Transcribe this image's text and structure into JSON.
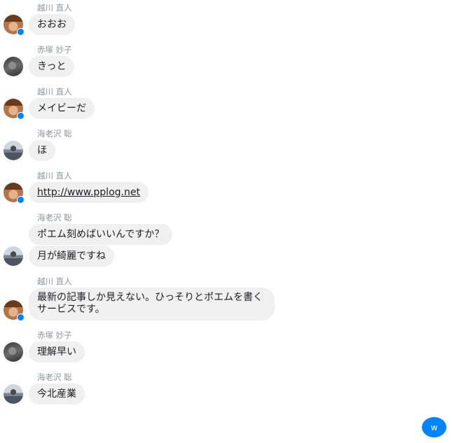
{
  "colors": {
    "bubble_bg": "#f1f0f0",
    "sender_text": "#90949c",
    "messenger_blue": "#0084ff"
  },
  "messages": [
    {
      "sender": "越川 直人",
      "texts": [
        "おおお"
      ]
    },
    {
      "sender": "赤塚 妙子",
      "texts": [
        "きっと"
      ]
    },
    {
      "sender": "越川 直人",
      "texts": [
        "メイビーだ"
      ]
    },
    {
      "sender": "海老沢 聡",
      "texts": [
        "ほ"
      ]
    },
    {
      "sender": "越川 直人",
      "texts": [
        "http://www.pplog.net"
      ]
    },
    {
      "sender": "海老沢 聡",
      "texts": [
        "ポエム刻めばいいんですか？",
        "月が綺麗ですね"
      ]
    },
    {
      "sender": "越川 直人",
      "texts": [
        "最新の記事しか見えない。ひっそりとポエムを書くサービスです。"
      ]
    },
    {
      "sender": "赤塚 妙子",
      "texts": [
        "理解早い"
      ]
    },
    {
      "sender": "海老沢 聡",
      "texts": [
        "今北産業"
      ]
    }
  ],
  "avatars": {
    "koshikawa": "avatar-koshikawa",
    "akatsuka": "avatar-akatsuka",
    "ebisawa": "avatar-ebisawa"
  },
  "fab": {
    "label": "w"
  }
}
